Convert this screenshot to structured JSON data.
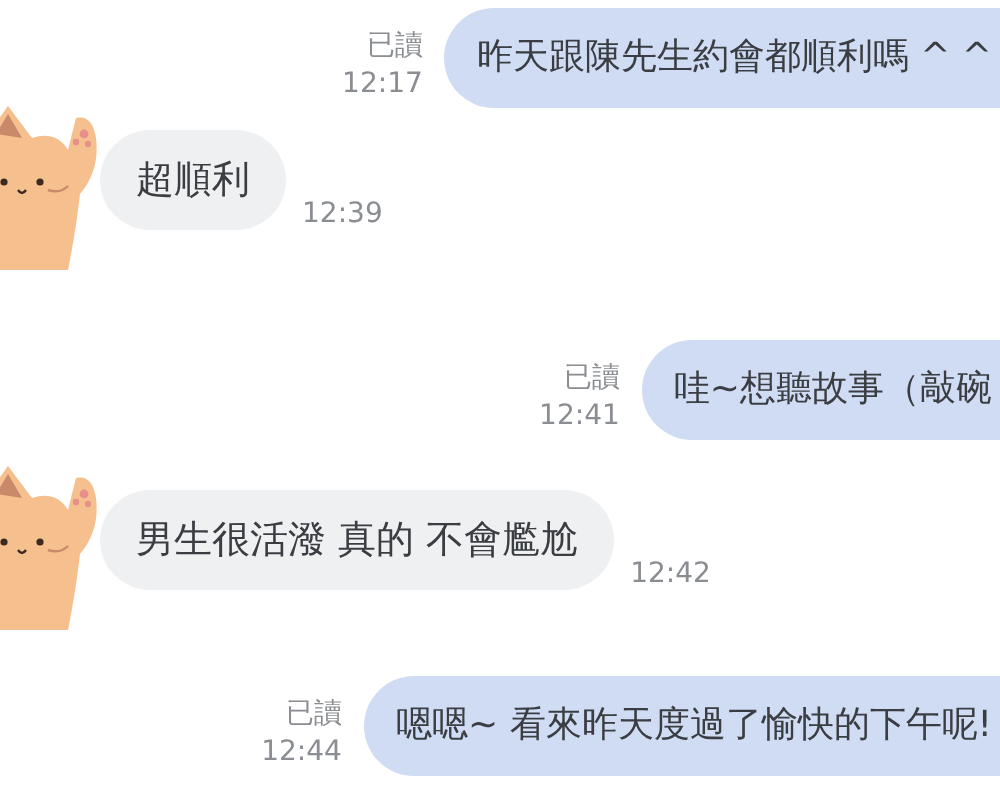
{
  "messages": [
    {
      "kind": "sent",
      "text": "昨天跟陳先生約會都順利嗎 ^ ^",
      "read_label": "已讀",
      "time": "12:17"
    },
    {
      "kind": "received",
      "text": "超順利",
      "time": "12:39"
    },
    {
      "kind": "sent",
      "text": "哇~想聽故事（敲碗",
      "read_label": "已讀",
      "time": "12:41"
    },
    {
      "kind": "received",
      "text": "男生很活潑 真的 不會尷尬",
      "time": "12:42"
    },
    {
      "kind": "sent",
      "text": "嗯嗯~ 看來昨天度過了愉快的下午呢!",
      "read_label": "已讀",
      "time": "12:44"
    }
  ]
}
